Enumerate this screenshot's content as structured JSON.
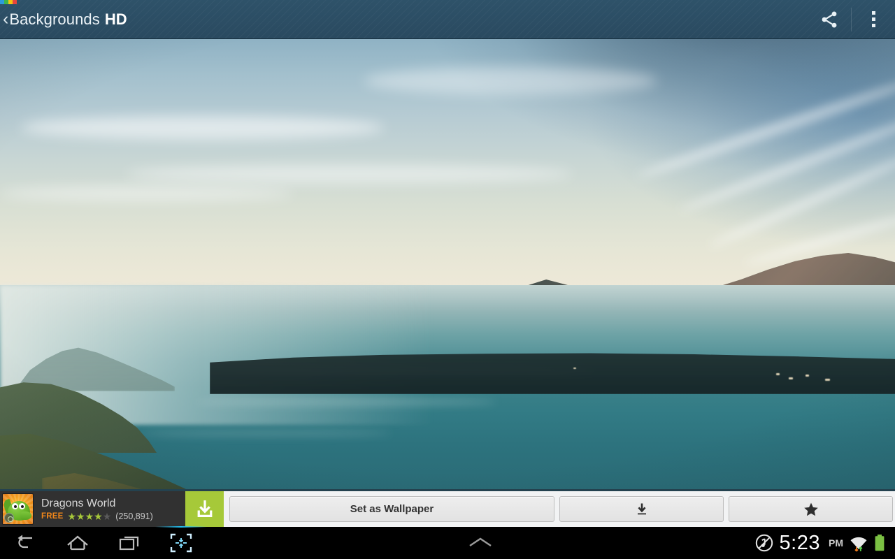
{
  "app": {
    "title": "Backgrounds",
    "title_bold": "HD",
    "back_icon": "‹"
  },
  "action_bar": {
    "share_icon": "share-icon",
    "overflow_icon": "overflow-menu-icon",
    "background_color": "#2c5068",
    "brand_dots": [
      "#2d9cdb",
      "#3fb54a",
      "#f2c511",
      "#e8453c"
    ]
  },
  "wallpaper": {
    "description": "Lake with mountains at dusk",
    "accent_water": "#3b8189",
    "accent_sky": "#b6cbd3"
  },
  "ad": {
    "title": "Dragons World",
    "price_label": "FREE",
    "rating": 4,
    "rating_max": 5,
    "review_count": "(250,891)",
    "install_icon": "download-icon",
    "install_color": "#a6c939",
    "progress_color": "#13b5e8",
    "icon_name": "dragon-app-icon"
  },
  "controls": {
    "set_wallpaper_label": "Set as Wallpaper",
    "download_icon": "download-icon",
    "favorite_icon": "star-icon"
  },
  "nav_bar": {
    "back_icon": "back-arrow-icon",
    "home_icon": "home-icon",
    "recents_icon": "recent-apps-icon",
    "screenshot_icon": "screenshot-icon",
    "notification_handle_icon": "chevron-up-icon",
    "mute_icon": "mute-icon",
    "time": "5:23",
    "ampm": "PM",
    "wifi_icon": "wifi-icon",
    "data_icon": "data-transfer-icon",
    "battery_icon": "battery-full-icon",
    "battery_color": "#7bc043",
    "active_highlight": "#23bff0"
  }
}
